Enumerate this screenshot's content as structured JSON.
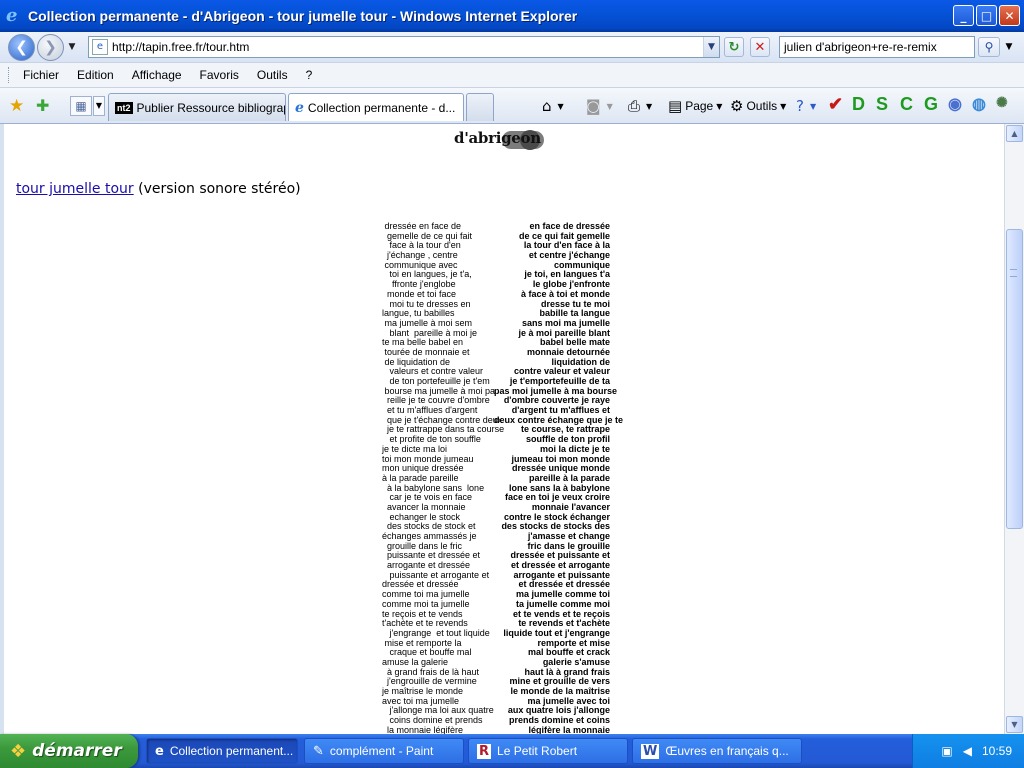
{
  "window": {
    "title": "Collection permanente - d'Abrigeon - tour jumelle tour - Windows Internet Explorer",
    "controls": {
      "minimize": "_",
      "maximize": "□",
      "close": "✕"
    }
  },
  "address_bar": {
    "url": "http://tapin.free.fr/tour.htm",
    "search_value": "julien d'abrigeon+re-re-remix"
  },
  "menu": [
    "Fichier",
    "Edition",
    "Affichage",
    "Favoris",
    "Outils",
    "?"
  ],
  "tabs": [
    {
      "label": "Publier Ressource bibliograph...",
      "icon": "nt2",
      "active": false
    },
    {
      "label": "Collection permanente - d...",
      "icon": "ie",
      "active": true
    }
  ],
  "commands": {
    "page": "Page",
    "outils": "Outils"
  },
  "extensions": [
    "D",
    "S",
    "C",
    "G"
  ],
  "page": {
    "logo_text": "d'abrigeon",
    "link_text": "tour jumelle tour",
    "link_suffix": " (version sonore stéréo)"
  },
  "poem": {
    "left": [
      " dressée en face de",
      "  gemelle de ce qui fait",
      "   face à la tour d'en",
      "  j'échange , centre",
      " communique avec",
      "   toi en langues, je t'a,",
      "    ffronte j'englobe",
      "  monde et toi face",
      "   moi tu te dresses en",
      "langue, tu babilles",
      " ma jumelle à moi sem",
      "   blant  pareille à moi je",
      "te ma belle babel en",
      " tourée de monnaie et",
      " de liquidation de",
      "   valeurs et contre valeur",
      "   de ton portefeuille je t'em",
      " bourse ma jumelle à moi pa",
      "  reille je te couvre d'ombre",
      "  et tu m'afflues d'argent",
      "  que je t'échange contre deux",
      "  je te rattrappe dans ta course",
      "   et profite de ton souffle",
      "je te dicte ma loi",
      "toi mon monde jumeau",
      "mon unique dressée",
      "à la parade pareille",
      "  à la babylone sans  lone",
      "   car je te vois en face",
      "  avancer la monnaie",
      "   echanger le stock",
      "  des stocks de stock et",
      "échanges ammassés je",
      "  grouille dans le fric",
      "  puissante et dressée et",
      "  arrogante et dressée",
      "   puissante et arrogante et",
      "dressée et dressée",
      "comme toi ma jumelle",
      "comme moi ta jumelle",
      "te reçois et te vends",
      "t'achète et te revends",
      "   j'engrange  et tout liquide",
      " mise et remporte la",
      "   craque et bouffe mal",
      "amuse la galerie",
      "  à grand frais de là haut",
      "  j'engrouille de vermine",
      "je maîtrise le monde",
      "avec toi ma jumelle",
      "   j'allonge ma loi aux quatre",
      "   coins domine et prends",
      "  la monnaie légifère"
    ],
    "right": [
      "en face de dressée",
      "de ce qui fait gemelle",
      "la tour d'en face à la",
      "et centre j'échange",
      "communique",
      "je toi, en langues t'a",
      "le globe j'enfronte",
      "à face à toi et monde",
      "dresse tu te moi",
      "babille ta langue",
      "sans moi ma jumelle",
      "je à moi pareille blant",
      "babel belle mate",
      "monnaie detournée",
      "liquidation de",
      "contre valeur et valeur",
      "je t'emportefeuille de ta",
      "pas moi jumelle à ma bourse",
      "d'ombre couverte je raye",
      "d'argent tu m'afflues et",
      "deux contre échange que je te",
      "te course, te rattrape",
      "souffle de ton profil",
      "moi la dicte je te",
      "jumeau toi mon monde",
      "dressée unique monde",
      "pareille à la parade",
      "lone sans la à babylone",
      "face en toi je veux croire",
      "monnaie l'avancer",
      "contre le stock échanger",
      "des stocks de stocks des",
      "j'amasse et change",
      "fric dans le grouille",
      "dressée et puissante et",
      "et dressée et arrogante",
      "arrogante et puissante",
      "et dressée et dressée",
      "ma jumelle comme toi",
      "ta jumelle comme moi",
      "et te vends et te reçois",
      "te revends et t'achète",
      "liquide tout et j'engrange",
      "remporte et mise",
      "mal bouffe et crack",
      "galerie s'amuse",
      "haut là à grand frais",
      "mine et grouille de vers",
      "le monde de la maîtrise",
      "ma jumelle avec toi",
      "aux quatre lois j'allonge",
      "prends domine et coins",
      "légifère la monnaie"
    ]
  },
  "taskbar": {
    "start_label": "démarrer",
    "tasks": [
      {
        "label": "Collection permanent...",
        "icon": "ie",
        "active": true
      },
      {
        "label": "complément - Paint",
        "icon": "paint",
        "active": false
      },
      {
        "label": "Le Petit Robert",
        "icon": "R",
        "active": false
      },
      {
        "label": "Œuvres en français q...",
        "icon": "W",
        "active": false
      }
    ],
    "clock": "10:59"
  }
}
